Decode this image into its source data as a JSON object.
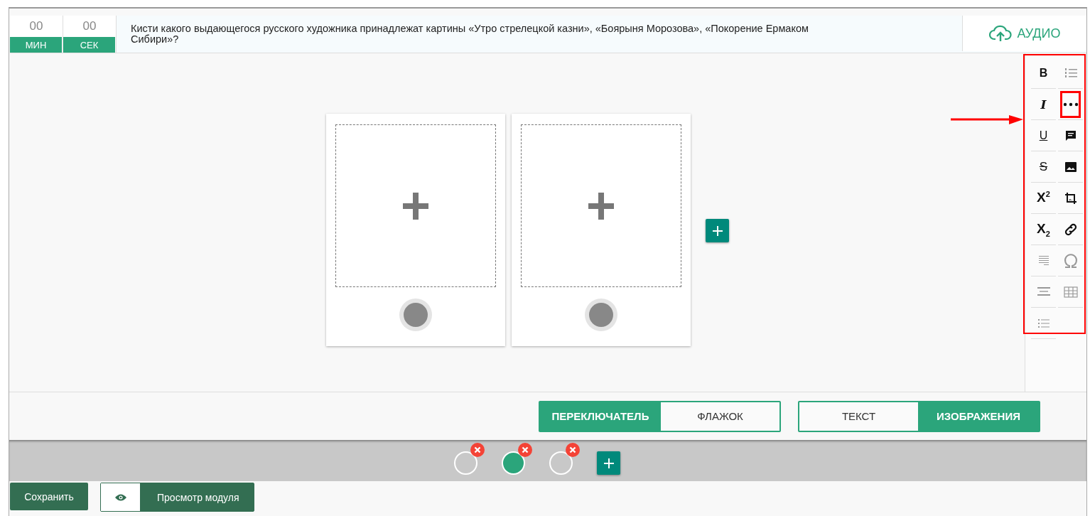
{
  "timer": [
    {
      "value": "00",
      "unit": "МИН"
    },
    {
      "value": "00",
      "unit": "СЕК"
    }
  ],
  "question": "Кисти какого выдающегося русского художника принадлежат картины «Утро стрелецкой казни», «Боярыня Морозова», «Покорение Ермаком Сибири»?",
  "audio_button": "АУДИО",
  "toolbar": {
    "highlighted": true,
    "items": [
      {
        "kind": "bold",
        "label": "B",
        "disabled": false,
        "highlighted": false
      },
      {
        "kind": "ordered-list",
        "disabled": true,
        "highlighted": false
      },
      {
        "kind": "italic",
        "label": "I",
        "disabled": false,
        "highlighted": false
      },
      {
        "kind": "more",
        "disabled": false,
        "highlighted": true
      },
      {
        "kind": "underline",
        "label": "U",
        "disabled": false,
        "highlighted": false
      },
      {
        "kind": "comment",
        "disabled": false,
        "highlighted": false
      },
      {
        "kind": "strike",
        "label": "S",
        "disabled": false,
        "highlighted": false
      },
      {
        "kind": "image",
        "disabled": false,
        "highlighted": false
      },
      {
        "kind": "superscript",
        "label": "X$^{2}$",
        "disabled": false,
        "highlighted": false
      },
      {
        "kind": "crop",
        "disabled": false,
        "highlighted": false
      },
      {
        "kind": "subscript",
        "label": "X$_{2}$",
        "disabled": false,
        "highlighted": false
      },
      {
        "kind": "link",
        "disabled": false,
        "highlighted": false
      },
      {
        "kind": "justify",
        "disabled": true,
        "highlighted": false
      },
      {
        "kind": "omega",
        "disabled": true,
        "highlighted": false
      },
      {
        "kind": "align-center",
        "disabled": true,
        "highlighted": false
      },
      {
        "kind": "table",
        "disabled": true,
        "highlighted": false
      },
      {
        "kind": "bullet-list",
        "disabled": true,
        "highlighted": false
      }
    ]
  },
  "answers": [
    {
      "kind": "picture-slot",
      "correct": false
    },
    {
      "kind": "picture-slot",
      "correct": false
    }
  ],
  "answer_mode": [
    {
      "label": "ПЕРЕКЛЮЧАТЕЛЬ",
      "selected": true
    },
    {
      "label": "ФЛАЖОК",
      "selected": false
    }
  ],
  "content_type": [
    {
      "label": "ТЕКСТ",
      "selected": false
    },
    {
      "label": "ИЗОБРАЖЕНИЯ",
      "selected": true
    }
  ],
  "pages": [
    {
      "selected": false
    },
    {
      "selected": true
    },
    {
      "selected": false
    }
  ],
  "save_button": "Сохранить",
  "preview_button": "Просмотр модуля"
}
